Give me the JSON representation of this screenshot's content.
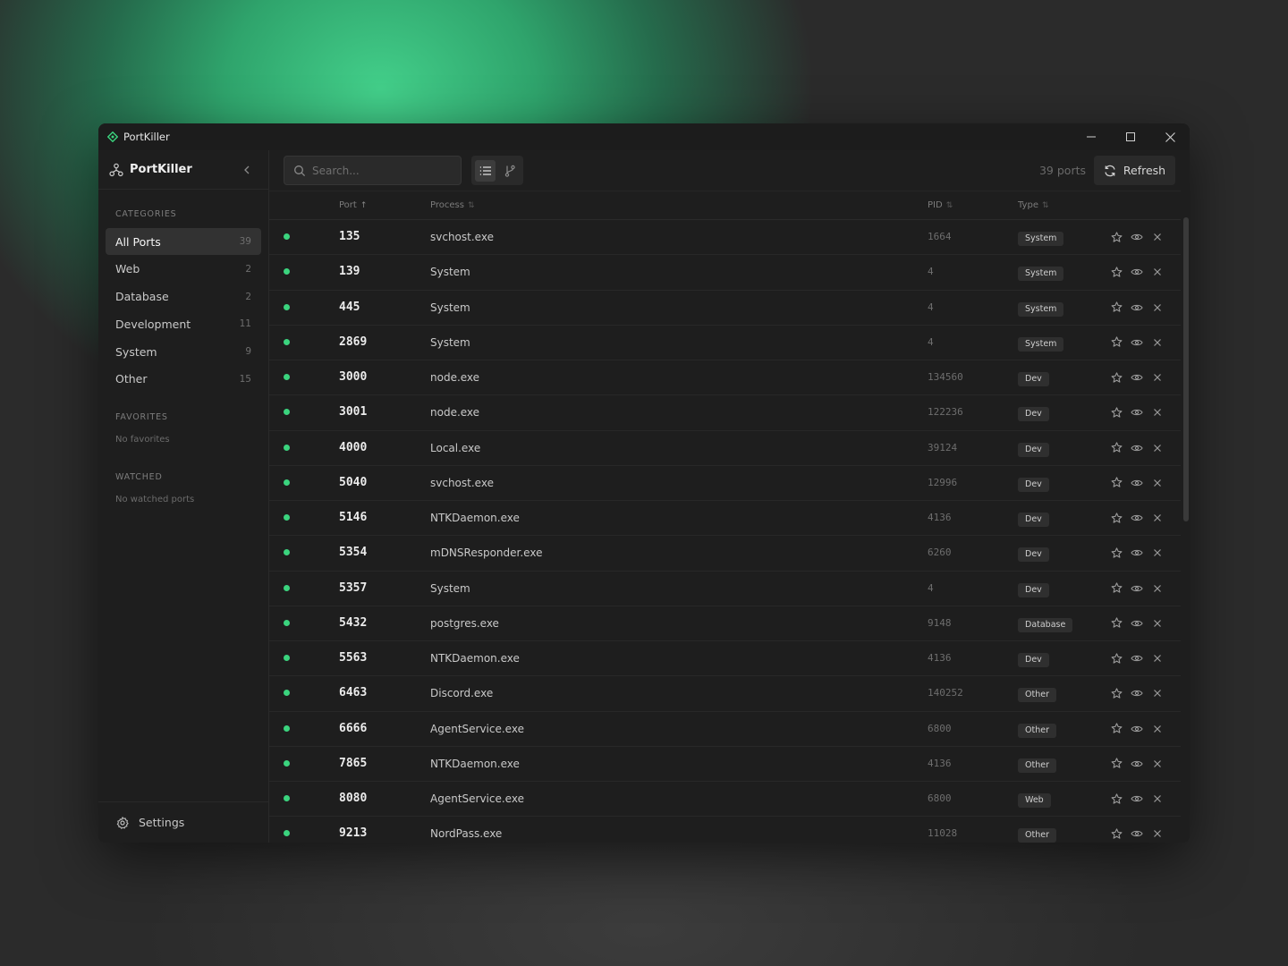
{
  "titlebar": {
    "app_title": "PortKiller"
  },
  "sidebar": {
    "brand": "PortKiller",
    "categories_label": "CATEGORIES",
    "categories": [
      {
        "name": "All Ports",
        "count": "39",
        "active": true
      },
      {
        "name": "Web",
        "count": "2"
      },
      {
        "name": "Database",
        "count": "2"
      },
      {
        "name": "Development",
        "count": "11"
      },
      {
        "name": "System",
        "count": "9"
      },
      {
        "name": "Other",
        "count": "15"
      }
    ],
    "favorites_label": "FAVORITES",
    "favorites_empty": "No favorites",
    "watched_label": "WATCHED",
    "watched_empty": "No watched ports",
    "settings_label": "Settings"
  },
  "toolbar": {
    "search_placeholder": "Search...",
    "port_count": "39 ports",
    "refresh_label": "Refresh"
  },
  "table": {
    "columns": {
      "port": "Port",
      "process": "Process",
      "pid": "PID",
      "type": "Type"
    },
    "rows": [
      {
        "port": "135",
        "process": "svchost.exe",
        "pid": "1664",
        "type": "System"
      },
      {
        "port": "139",
        "process": "System",
        "pid": "4",
        "type": "System"
      },
      {
        "port": "445",
        "process": "System",
        "pid": "4",
        "type": "System"
      },
      {
        "port": "2869",
        "process": "System",
        "pid": "4",
        "type": "System"
      },
      {
        "port": "3000",
        "process": "node.exe",
        "pid": "134560",
        "type": "Dev"
      },
      {
        "port": "3001",
        "process": "node.exe",
        "pid": "122236",
        "type": "Dev"
      },
      {
        "port": "4000",
        "process": "Local.exe",
        "pid": "39124",
        "type": "Dev"
      },
      {
        "port": "5040",
        "process": "svchost.exe",
        "pid": "12996",
        "type": "Dev"
      },
      {
        "port": "5146",
        "process": "NTKDaemon.exe",
        "pid": "4136",
        "type": "Dev"
      },
      {
        "port": "5354",
        "process": "mDNSResponder.exe",
        "pid": "6260",
        "type": "Dev"
      },
      {
        "port": "5357",
        "process": "System",
        "pid": "4",
        "type": "Dev"
      },
      {
        "port": "5432",
        "process": "postgres.exe",
        "pid": "9148",
        "type": "Database"
      },
      {
        "port": "5563",
        "process": "NTKDaemon.exe",
        "pid": "4136",
        "type": "Dev"
      },
      {
        "port": "6463",
        "process": "Discord.exe",
        "pid": "140252",
        "type": "Other"
      },
      {
        "port": "6666",
        "process": "AgentService.exe",
        "pid": "6800",
        "type": "Other"
      },
      {
        "port": "7865",
        "process": "NTKDaemon.exe",
        "pid": "4136",
        "type": "Other"
      },
      {
        "port": "8080",
        "process": "AgentService.exe",
        "pid": "6800",
        "type": "Web"
      },
      {
        "port": "9213",
        "process": "NordPass.exe",
        "pid": "11028",
        "type": "Other"
      }
    ]
  },
  "colors": {
    "accent": "#3bd47e",
    "window_bg": "#1d1d1d",
    "badge_bg": "#2f2f2f"
  }
}
